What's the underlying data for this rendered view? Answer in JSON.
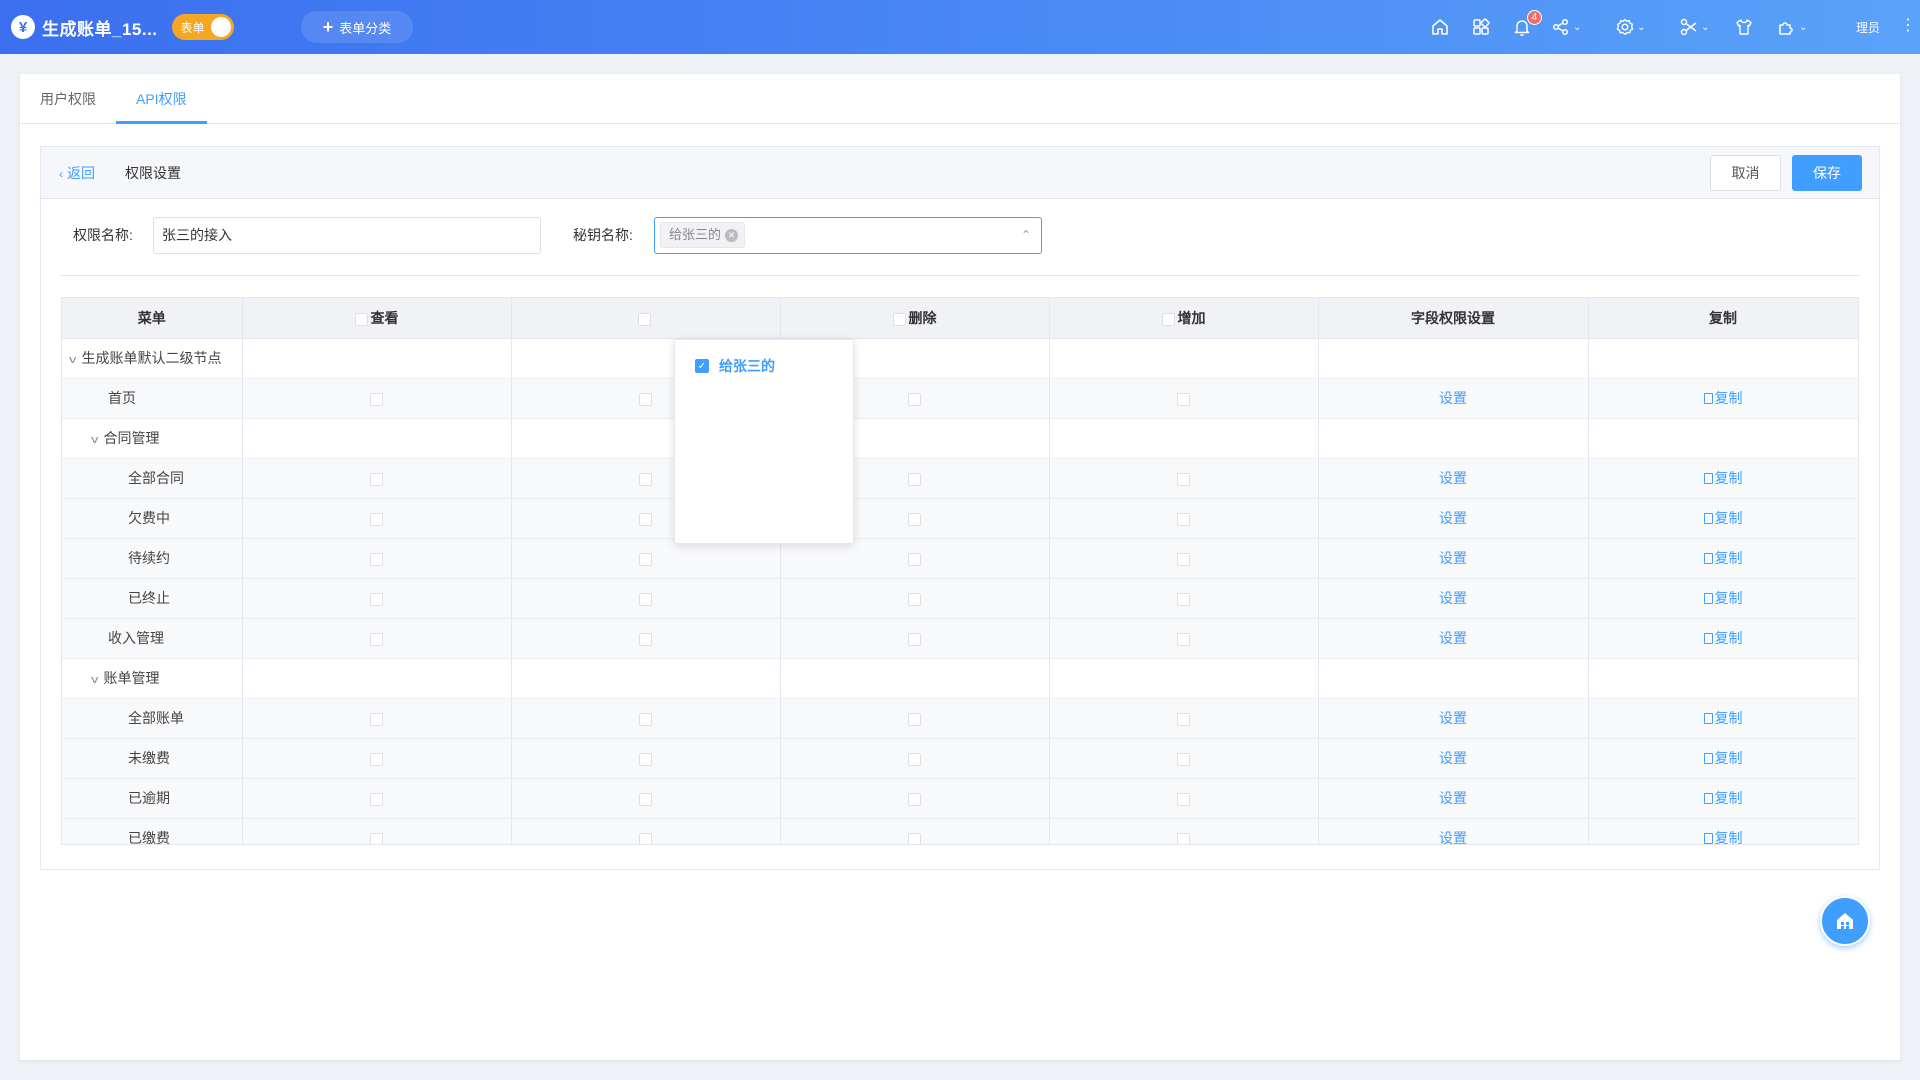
{
  "header": {
    "logo_glyph": "¥",
    "app_title": "生成账单_15...",
    "toggle_label": "表单",
    "category_button": "表单分类",
    "notification_count": "4",
    "user_name": "理员"
  },
  "tabs": [
    {
      "label": "用户权限",
      "active": false
    },
    {
      "label": "API权限",
      "active": true
    }
  ],
  "toolbar": {
    "back_label": "返回",
    "title": "权限设置",
    "cancel_label": "取消",
    "save_label": "保存"
  },
  "form": {
    "perm_name_label": "权限名称:",
    "perm_name_value": "张三的接入",
    "key_name_label": "秘钥名称:",
    "key_tag": "给张三的"
  },
  "dropdown": {
    "option_label": "给张三的",
    "checked": true
  },
  "table": {
    "columns": {
      "menu": "菜单",
      "view": "查看",
      "delete": "删除",
      "add": "增加",
      "field": "字段权限设置",
      "copy": "复制"
    },
    "set_label": "设置",
    "copy_label": "复制",
    "rows": [
      {
        "label": "生成账单默认二级节点",
        "level": 0,
        "group": true
      },
      {
        "label": "首页",
        "level": 1,
        "group": false
      },
      {
        "label": "合同管理",
        "level": 1,
        "group": true
      },
      {
        "label": "全部合同",
        "level": 2,
        "group": false
      },
      {
        "label": "欠费中",
        "level": 2,
        "group": false
      },
      {
        "label": "待续约",
        "level": 2,
        "group": false
      },
      {
        "label": "已终止",
        "level": 2,
        "group": false
      },
      {
        "label": "收入管理",
        "level": 1,
        "group": false
      },
      {
        "label": "账单管理",
        "level": 1,
        "group": true
      },
      {
        "label": "全部账单",
        "level": 2,
        "group": false
      },
      {
        "label": "未缴费",
        "level": 2,
        "group": false
      },
      {
        "label": "已逾期",
        "level": 2,
        "group": false
      },
      {
        "label": "已缴费",
        "level": 2,
        "group": false
      }
    ]
  }
}
